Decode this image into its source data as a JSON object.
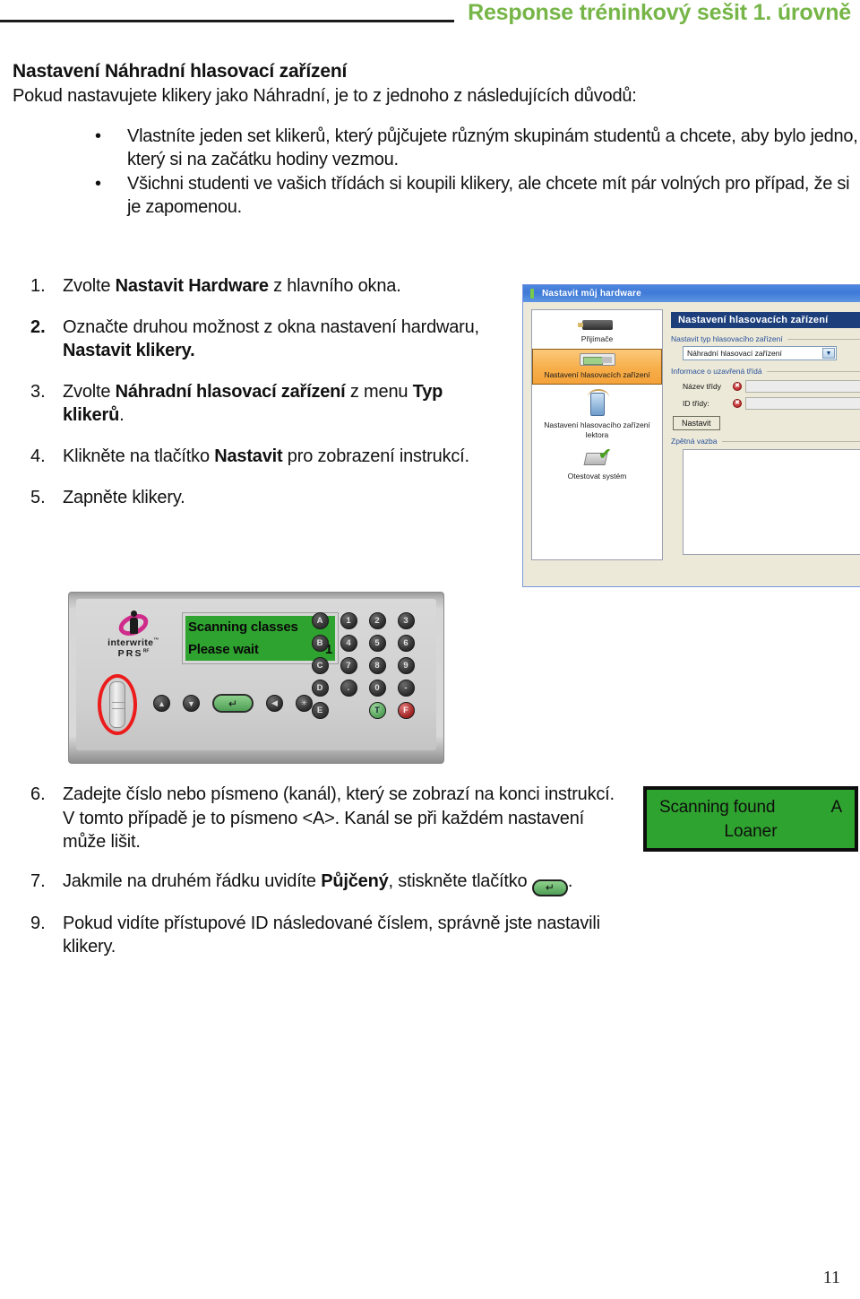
{
  "header": {
    "title": "Response tréninkový sešit 1. úrovně",
    "accent_color": "#76b547"
  },
  "intro": {
    "heading": "Nastavení Náhradní hlasovací zařízení",
    "lead": "Pokud nastavujete klikery jako Náhradní, je to z jednoho z následujících důvodů:",
    "bullet_glyph": "•",
    "bullets": [
      "Vlastníte jeden set klikerů, který půjčujete různým skupinám studentů a chcete, aby bylo jedno, který si na začátku hodiny vezmou.",
      "Všichni studenti ve vašich třídách si koupili klikery, ale chcete mít pár volných pro případ, že si je zapomenou."
    ]
  },
  "steps_upper": [
    {
      "num": "1.",
      "num_bold": false,
      "parts": [
        {
          "t": "Zvolte ",
          "b": false
        },
        {
          "t": "Nastavit Hardware",
          "b": true
        },
        {
          "t": " z hlavního okna.",
          "b": false
        }
      ]
    },
    {
      "num": "2.",
      "num_bold": true,
      "parts": [
        {
          "t": "Označte druhou možnost z okna  nastavení hardwaru, ",
          "b": false
        },
        {
          "t": "Nastavit klikery.",
          "b": true
        }
      ]
    },
    {
      "num": "3.",
      "num_bold": false,
      "parts": [
        {
          "t": "Zvolte ",
          "b": false
        },
        {
          "t": "Náhradní hlasovací zařízení",
          "b": true
        },
        {
          "t": " z menu ",
          "b": false
        },
        {
          "t": "Typ klikerů",
          "b": true
        },
        {
          "t": ".",
          "b": false
        }
      ]
    },
    {
      "num": "4.",
      "num_bold": false,
      "parts": [
        {
          "t": "Klikněte na tlačítko ",
          "b": false
        },
        {
          "t": "Nastavit",
          "b": true
        },
        {
          "t": " pro zobrazení instrukcí.",
          "b": false
        }
      ]
    },
    {
      "num": "5.",
      "num_bold": false,
      "parts": [
        {
          "t": "Zapněte klikery.",
          "b": false
        }
      ]
    }
  ],
  "steps_lower": [
    {
      "num": "6.",
      "parts": [
        {
          "t": "Zadejte číslo nebo písmeno (kanál), který se zobrazí na konci instrukcí.  V tomto případě je to písmeno <A>.  Kanál se při každém nastavení může lišit.",
          "b": false
        }
      ],
      "icon": null
    },
    {
      "num": "7.",
      "parts": [
        {
          "t": "Jakmile na druhém řádku uvidíte ",
          "b": false
        },
        {
          "t": "Půjčený",
          "b": true
        },
        {
          "t": ", stiskněte tlačítko ",
          "b": false
        }
      ],
      "icon": "enter-arrow-icon",
      "icon_glyph": "↵",
      "tail": "."
    },
    {
      "num": "9.",
      "parts": [
        {
          "t": "Pokud vidíte přístupové ID následované číslem, správně jste nastavili klikery.",
          "b": false
        }
      ],
      "icon": null
    }
  ],
  "app_window": {
    "title": "Nastavit můj hardware",
    "nav_items": [
      {
        "label": "Přijímače",
        "icon": "receiver-icon",
        "selected": false
      },
      {
        "label": "Nastavení hlasovacích zařízení",
        "icon": "clicker-icon",
        "selected": true
      },
      {
        "label": "Nastavení hlasovacího zařízení lektora",
        "icon": "instructor-clicker-icon",
        "selected": false
      },
      {
        "label": "Otestovat systém",
        "icon": "test-system-icon",
        "selected": false
      }
    ],
    "panel_title": "Nastavení hlasovacích zařízení",
    "group1_label": "Nastavit typ hlasovacího zařízení",
    "device_type_value": "Náhradní hlasovací zařízení",
    "group2_label": "Informace o uzavřená třídá",
    "fields": [
      {
        "label": "Název třídy",
        "value": "",
        "error": true
      },
      {
        "label": "ID třídy:",
        "value": "",
        "error": true
      }
    ],
    "button_label": "Nastavit",
    "group3_label": "Zpětná vazba",
    "feedback_value": "",
    "error_glyph": "✖"
  },
  "device": {
    "brand_line1": "interwrite",
    "brand_line1_sup": "™",
    "brand_line2": "PRS",
    "brand_line2_sup": "RF",
    "lcd": {
      "line1_left": "Scanning classes",
      "line1_right": "",
      "line2_left": "Please wait",
      "line2_right": "1"
    },
    "control_buttons": [
      {
        "name": "up-arrow-button",
        "glyph": "▲"
      },
      {
        "name": "down-arrow-button",
        "glyph": "▼"
      },
      {
        "name": "enter-button",
        "glyph": "↵"
      },
      {
        "name": "left-arrow-button",
        "glyph": "◀"
      },
      {
        "name": "star-button",
        "glyph": "✳"
      }
    ],
    "keypad": [
      [
        "A",
        "1",
        "2",
        "3"
      ],
      [
        "B",
        "4",
        "5",
        "6"
      ],
      [
        "C",
        "7",
        "8",
        "9"
      ],
      [
        "D",
        ".",
        "0",
        "-"
      ],
      [
        "E",
        "",
        "T",
        "F"
      ]
    ],
    "power_slider_highlight_color": "#ec1c1c"
  },
  "lcd_result": {
    "line1_left": "Scanning found",
    "line1_right": "A",
    "line2": "Loaner",
    "background_color": "#2fa32f"
  },
  "footer": {
    "page_number": "11"
  }
}
